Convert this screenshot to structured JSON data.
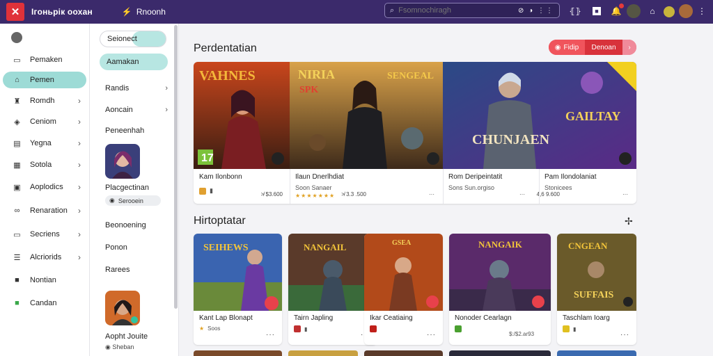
{
  "topbar": {
    "brand": "Ігоньрік оохан",
    "nav_link": "Rnoonh",
    "search_placeholder": "Fsomnochiragh",
    "search_tools": "⊘ ◑ ⋮⋮"
  },
  "sidebar": {
    "items": [
      {
        "label": "Pemaken",
        "icon": "store-icon",
        "chevron": false
      },
      {
        "label": "Pemen",
        "icon": "home-icon",
        "chevron": false,
        "active": true
      },
      {
        "label": "Romdh",
        "icon": "gamepad-icon",
        "chevron": true
      },
      {
        "label": "Ceniom",
        "icon": "tag-icon",
        "chevron": true
      },
      {
        "label": "Yegna",
        "icon": "list-icon",
        "chevron": true
      },
      {
        "label": "Sotola",
        "icon": "grid-icon",
        "chevron": true
      },
      {
        "label": "Aoplodics",
        "icon": "apps-icon",
        "chevron": true
      },
      {
        "label": "Renaration",
        "icon": "link-icon",
        "chevron": true
      },
      {
        "label": "Secriens",
        "icon": "monitor-icon",
        "chevron": true
      },
      {
        "label": "Alcriorids",
        "icon": "layers-icon",
        "chevron": true
      },
      {
        "label": "Nontian",
        "icon": "square-icon",
        "chevron": false
      },
      {
        "label": "Candan",
        "icon": "green-square-icon",
        "chevron": false
      }
    ]
  },
  "col2": {
    "pill1": "Seionect",
    "pill2": "Aamakan",
    "item1": "Randis",
    "item2": "Aoncain",
    "head1": "Peneenhah",
    "avatar1_name": "Placgectinan",
    "avatar1_tag": "Serooein",
    "item3": "Beonoening",
    "item4": "Ponon",
    "item5": "Rarees",
    "avatar2_name": "Aopht Jouite",
    "avatar2_tag": "Sheban"
  },
  "main": {
    "section1_title": "Perdentatian",
    "filter1": "Fidip",
    "filter2": "Denoan",
    "section2_title": "Hirtoptatar",
    "featured": [
      {
        "name": "Kam Ilonbonn",
        "sub": "",
        "meta": "≯ $3.600"
      },
      {
        "name": "Ilaun Dnerlhdiat",
        "sub": "Soon Sanaer",
        "meta": "≯ 3.3 .500"
      },
      {
        "name": "Rom Deripeintatit",
        "sub": "Sons Sun.orgiso",
        "meta": "···"
      },
      {
        "name": "Pam Ilondolaniat",
        "sub": "Stonicees",
        "meta": "4,6 9.600"
      }
    ],
    "games": [
      {
        "name": "Kant Lap Blonapt",
        "sub": "Soos",
        "more": "···"
      },
      {
        "name": "Tairn Japling",
        "sub": "",
        "more": "···"
      },
      {
        "name": "Ikar Ceatiaing",
        "sub": "",
        "more": "···"
      },
      {
        "name": "Nonoder Cearlagn",
        "sub": "$:/$2.ar93",
        "more": "···"
      },
      {
        "name": "Taschlam Ioarg",
        "sub": "",
        "more": "···"
      }
    ]
  }
}
